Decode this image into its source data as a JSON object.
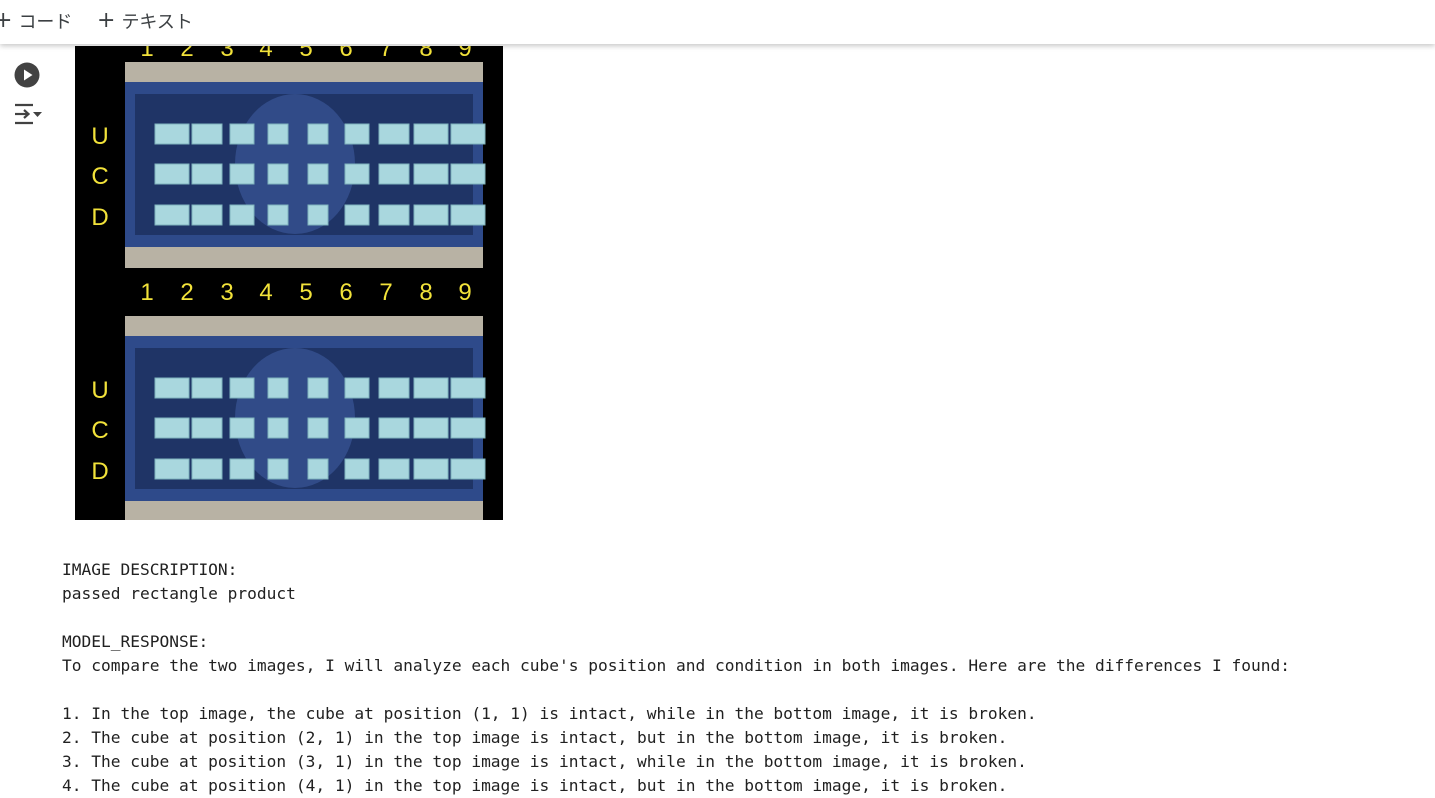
{
  "toolbar": {
    "add_code_label": "コード",
    "add_text_label": "テキスト",
    "plus_glyph": "+"
  },
  "cell": {
    "run_icon": "play-circle-icon",
    "output_icon": "output-toggle-icon"
  },
  "figure": {
    "column_numbers": [
      "1",
      "2",
      "3",
      "4",
      "5",
      "6",
      "7",
      "8",
      "9"
    ],
    "row_letters": [
      "U",
      "C",
      "D"
    ],
    "label_color": "#f2e23a",
    "tray_color": "#2e4a8a",
    "cube_color": "#a9d7de",
    "frame_color": "#b8b2a4"
  },
  "output": {
    "lines": [
      "IMAGE DESCRIPTION:",
      "passed rectangle product",
      "",
      "MODEL_RESPONSE:",
      "To compare the two images, I will analyze each cube's position and condition in both images. Here are the differences I found:",
      "",
      "1. In the top image, the cube at position (1, 1) is intact, while in the bottom image, it is broken.",
      "2. The cube at position (2, 1) in the top image is intact, but in the bottom image, it is broken.",
      "3. The cube at position (3, 1) in the top image is intact, while in the bottom image, it is broken.",
      "4. The cube at position (4, 1) in the top image is intact, but in the bottom image, it is broken."
    ]
  }
}
